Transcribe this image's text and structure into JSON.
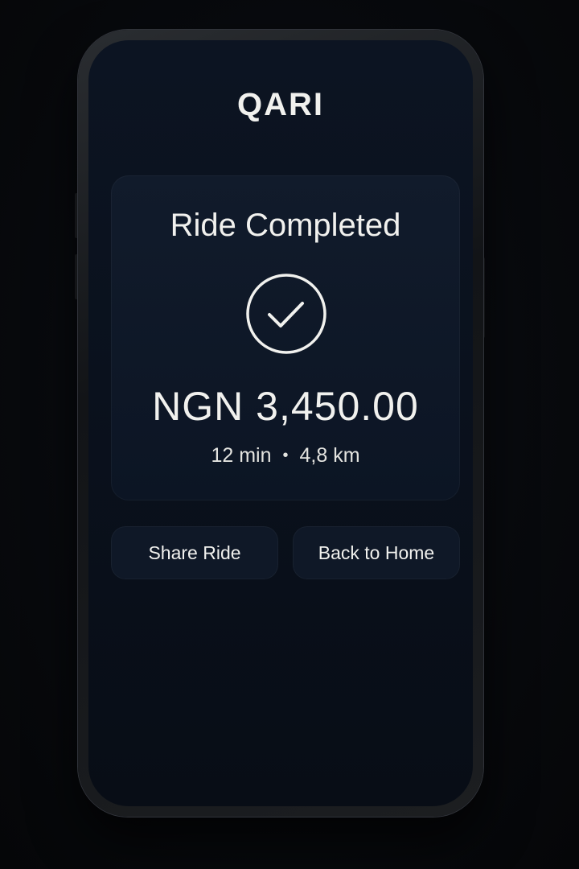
{
  "app": {
    "title": "QARI"
  },
  "ride_summary": {
    "status_title": "Ride Completed",
    "status_icon": "checkmark-circle-icon",
    "fare": "NGN 3,450.00",
    "duration": "12 min",
    "separator": "•",
    "distance": "4,8 km"
  },
  "actions": {
    "share_label": "Share Ride",
    "home_label": "Back to Home"
  },
  "colors": {
    "background": "#07090d",
    "screen": "#0b1320",
    "card": "#0f1928",
    "text": "#f1f1ee"
  }
}
